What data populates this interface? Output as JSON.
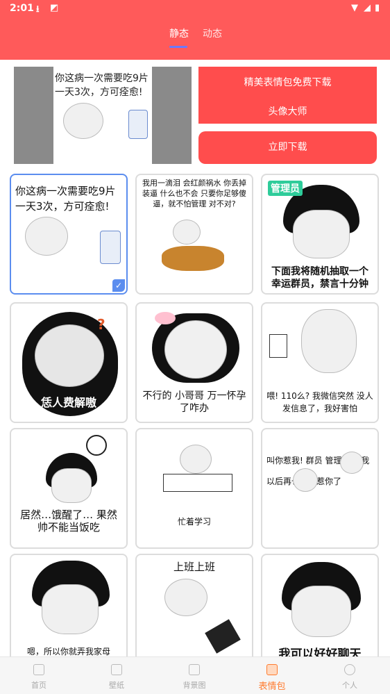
{
  "status_bar": {
    "time": "2:01"
  },
  "tabs": [
    "静态",
    "动态"
  ],
  "banner": {
    "image_text_line1": "你这病一次需要吃9片",
    "image_text_line2": "一天3次，方可痊愈!",
    "promo_line1": "精美表情包免费下载",
    "promo_line2": "头像大师",
    "download_button": "立即下载"
  },
  "stickers": [
    {
      "caption": "你这病一次需要吃9片 一天3次，方可痊愈!",
      "selected": true
    },
    {
      "caption": "我用一滴泪 会红颜祸水 你丢掉装逼 什么也不会 只要你足够傻逼，就不怕管理 对不对?"
    },
    {
      "badge": "管理员",
      "caption": "下面我将随机抽取一个 幸运群员，禁言十分钟"
    },
    {
      "caption": "恁人费解嗷"
    },
    {
      "caption": "不行的 小哥哥 万一怀孕了咋办"
    },
    {
      "caption": "喂! 110么? 我微信突然 没人发信息了，我好害怕"
    },
    {
      "caption": "居然…饿醒了… 果然帅不能当饭吃"
    },
    {
      "caption": "忙着学习"
    },
    {
      "caption": "叫你惹我! 群员 管理爸爸 我以后再也不敢惹你了"
    },
    {
      "caption": "嗯，所以你就弄我家母"
    },
    {
      "caption": "上班上班"
    },
    {
      "caption": "我可以好好聊天"
    }
  ],
  "bottom_nav": [
    {
      "label": "首页",
      "icon": "home-icon"
    },
    {
      "label": "壁纸",
      "icon": "wallpaper-icon"
    },
    {
      "label": "背景图",
      "icon": "image-icon"
    },
    {
      "label": "表情包",
      "icon": "sticker-icon",
      "active": true
    },
    {
      "label": "个人",
      "icon": "person-icon"
    }
  ],
  "colors": {
    "accent": "#ff5a5a",
    "nav_active": "#ff7b2e",
    "selection": "#5b8def"
  }
}
